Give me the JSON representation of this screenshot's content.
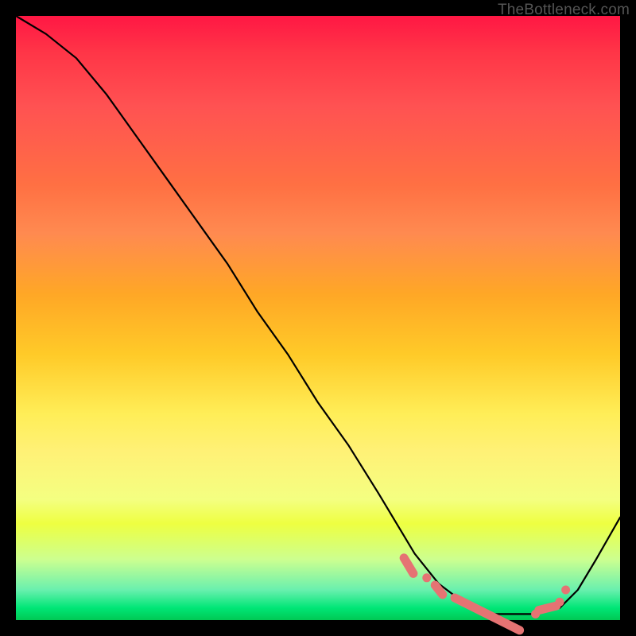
{
  "watermark": "TheBottleneck.com",
  "colors": {
    "dot": "#e57373",
    "curve": "#000000",
    "frame": "#000000"
  },
  "chart_data": {
    "type": "line",
    "title": "",
    "xlabel": "",
    "ylabel": "",
    "xlim": [
      0,
      100
    ],
    "ylim": [
      0,
      100
    ],
    "series": [
      {
        "name": "bottleneck-curve",
        "x": [
          0,
          5,
          10,
          15,
          20,
          25,
          30,
          35,
          40,
          45,
          50,
          55,
          60,
          63,
          66,
          70,
          74,
          78,
          82,
          86,
          90,
          93,
          96,
          100
        ],
        "y": [
          100,
          97,
          93,
          87,
          80,
          73,
          66,
          59,
          51,
          44,
          36,
          29,
          21,
          16,
          11,
          6,
          3,
          1,
          1,
          1,
          2,
          5,
          10,
          17
        ]
      }
    ],
    "markers": [
      {
        "shape": "pill",
        "x": 65,
        "y": 9,
        "len": 3
      },
      {
        "shape": "dot",
        "x": 68,
        "y": 7
      },
      {
        "shape": "pill",
        "x": 70,
        "y": 5,
        "len": 2
      },
      {
        "shape": "pill",
        "x": 78,
        "y": 1,
        "len": 12
      },
      {
        "shape": "dot",
        "x": 86,
        "y": 1
      },
      {
        "shape": "pill",
        "x": 88,
        "y": 2,
        "len": 3
      },
      {
        "shape": "dot",
        "x": 90,
        "y": 3
      },
      {
        "shape": "dot",
        "x": 91,
        "y": 5
      }
    ]
  }
}
